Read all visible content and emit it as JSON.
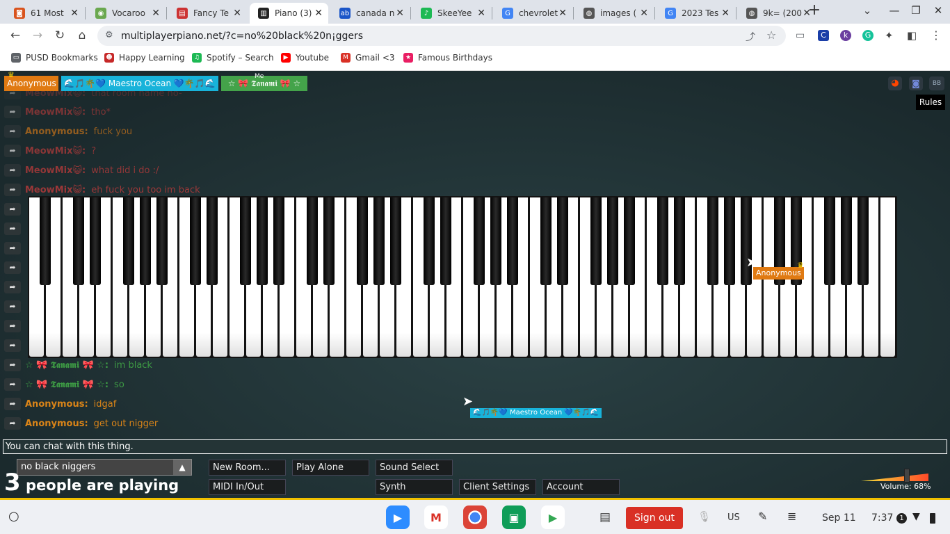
{
  "tabs": [
    {
      "title": "61 Most",
      "color": "#d9541e",
      "glyph": "◙"
    },
    {
      "title": "Vocaroo",
      "color": "#6aa84f",
      "glyph": "◉"
    },
    {
      "title": "Fancy Te",
      "color": "#cc3333",
      "glyph": "▤"
    },
    {
      "title": "Piano (3)",
      "color": "#222222",
      "glyph": "▥"
    },
    {
      "title": "canada n",
      "color": "#1a55c8",
      "glyph": "ab"
    },
    {
      "title": "SkeeYee",
      "color": "#1db954",
      "glyph": "♪"
    },
    {
      "title": "chevrolet",
      "color": "#4285f4",
      "glyph": "G"
    },
    {
      "title": "images (",
      "color": "#555555",
      "glyph": "◍"
    },
    {
      "title": "2023 Tes",
      "color": "#4285f4",
      "glyph": "G"
    },
    {
      "title": "9k= (200",
      "color": "#555555",
      "glyph": "◍"
    }
  ],
  "tab_close": "✕",
  "new_tab": "+",
  "window": {
    "minimize": "—",
    "restore": "❐",
    "close": "✕",
    "tab_search": "⌄"
  },
  "nav": {
    "back": "←",
    "forward": "→",
    "reload": "↻",
    "home": "⌂",
    "url": "multiplayerpiano.net/?c=no%20black%20n¡ggers"
  },
  "bookmarks": [
    {
      "label": "PUSD Bookmarks",
      "color": "#5f6368",
      "glyph": "▭"
    },
    {
      "label": "Happy Learning",
      "color": "#c62828",
      "glyph": "☻"
    },
    {
      "label": "Spotify – Search",
      "color": "#1db954",
      "glyph": "♫"
    },
    {
      "label": "Youtube",
      "color": "#ff0000",
      "glyph": "▶"
    },
    {
      "label": "Gmail <3",
      "color": "#d93025",
      "glyph": "M"
    },
    {
      "label": "Famous Birthdays",
      "color": "#e91e63",
      "glyph": "★"
    }
  ],
  "players": [
    {
      "name": "Anonymous",
      "color": "#e07a12"
    },
    {
      "name": "🌊🎵🌴💙 Maestro Ocean 💙🌴🎵🌊",
      "color": "#18b3da"
    },
    {
      "name": "☆ 🎀 𝕿𝖆𝖓𝖆𝖒𝖎 🎀 ☆",
      "color": "#44a34a",
      "me": "Me"
    }
  ],
  "top_faded": "that room name no-",
  "top_faded_name": "MeowMix😺:",
  "chat_reply_glyph": "➦",
  "chat": [
    {
      "name": "MeowMix😺:",
      "text": "tho*",
      "color": "#b23a3a",
      "op": 0.65
    },
    {
      "name": "Anonymous:",
      "text": "fuck you",
      "color": "#c8731a",
      "op": 0.7
    },
    {
      "name": "MeowMix😺:",
      "text": "?",
      "color": "#b23a3a",
      "op": 0.75
    },
    {
      "name": "MeowMix😺:",
      "text": "what did i do :/",
      "color": "#b23a3a",
      "op": 0.8
    },
    {
      "name": "MeowMix😺:",
      "text": "eh fuck you too im back",
      "color": "#b23a3a",
      "op": 0.85
    },
    {
      "name": "☆ 🎀 𝕿𝖆𝖓𝖆𝖒𝖎 🎀 ☆:",
      "text": "im black",
      "color": "#3d9a44",
      "op": 1
    },
    {
      "name": "☆ 🎀 𝕿𝖆𝖓𝖆𝖒𝖎 🎀 ☆:",
      "text": "so",
      "color": "#3d9a44",
      "op": 1
    },
    {
      "name": "Anonymous:",
      "text": "idgaf",
      "color": "#d98418",
      "op": 1
    },
    {
      "name": "Anonymous:",
      "text": "get out nigger",
      "color": "#d98418",
      "op": 1
    }
  ],
  "cursors": [
    {
      "name": "Anonymous",
      "color": "#e07a12"
    },
    {
      "name": "🌊🎵🌴💙 Maestro Ocean 💙🌴🎵🌊",
      "color": "#18b3da"
    }
  ],
  "rules": "Rules",
  "social": [
    "reddit-icon",
    "discord-icon",
    "bb-icon"
  ],
  "social_glyph": [
    "◕",
    "◙",
    "BB"
  ],
  "chat_placeholder": "You can chat with this thing.",
  "room_select": "no black niggers",
  "people_count": "3",
  "people_label": "people are playing",
  "buttons": {
    "new_room": "New Room...",
    "play_alone": "Play Alone",
    "sound_select": "Sound Select",
    "midi": "MIDI In/Out",
    "synth": "Synth",
    "client_settings": "Client Settings",
    "account": "Account"
  },
  "volume_label": "Volume: 68%",
  "volume": 0.68,
  "shelf": {
    "launcher": "○",
    "sign_out": "Sign out",
    "locale": "US",
    "date": "Sep 11",
    "time": "7:37",
    "notif": "1"
  }
}
